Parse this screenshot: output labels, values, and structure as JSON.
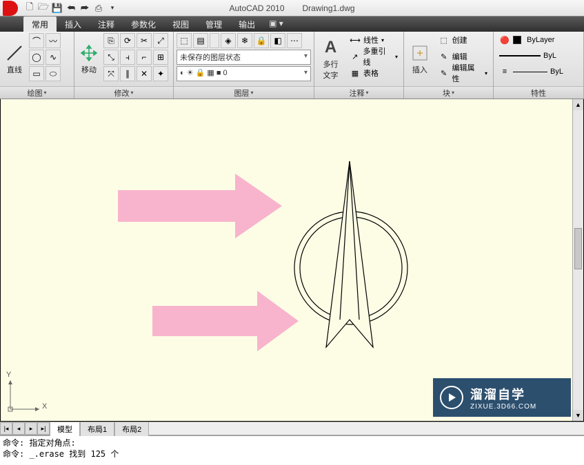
{
  "title": {
    "app": "AutoCAD 2010",
    "file": "Drawing1.dwg"
  },
  "qat_icons": [
    "new-icon",
    "open-icon",
    "save-icon",
    "undo-icon",
    "redo-icon",
    "print-icon"
  ],
  "menu": {
    "items": [
      "常用",
      "插入",
      "注释",
      "参数化",
      "视图",
      "管理",
      "输出"
    ],
    "extra": "▣ ▾"
  },
  "panels": {
    "draw": {
      "label": "绘图",
      "big": "直线"
    },
    "modify": {
      "label": "修改",
      "big": "移动"
    },
    "layers": {
      "label": "图层",
      "combo": "未保存的图层状态",
      "layer_prefix": "◐ ☀ 🔒 ▦ ■ 0"
    },
    "annot": {
      "label": "注释",
      "big1": "多行",
      "big2": "文字",
      "items": [
        "线性",
        "多重引线",
        "表格"
      ]
    },
    "block": {
      "label": "块",
      "big": "插入",
      "items": [
        "创建",
        "编辑",
        "编辑属性"
      ]
    },
    "props": {
      "label": "特性",
      "bylayer": "ByLayer",
      "byl_short": "ByL"
    }
  },
  "tabs": {
    "model": "模型",
    "layout1": "布局1",
    "layout2": "布局2"
  },
  "cmd": {
    "line1": "命令: 指定对角点:",
    "line2": "命令: _.erase 找到 125 个"
  },
  "ucs": {
    "x": "X",
    "y": "Y"
  },
  "watermark": {
    "big": "溜溜自学",
    "small": "ZIXUE.3D66.COM"
  }
}
